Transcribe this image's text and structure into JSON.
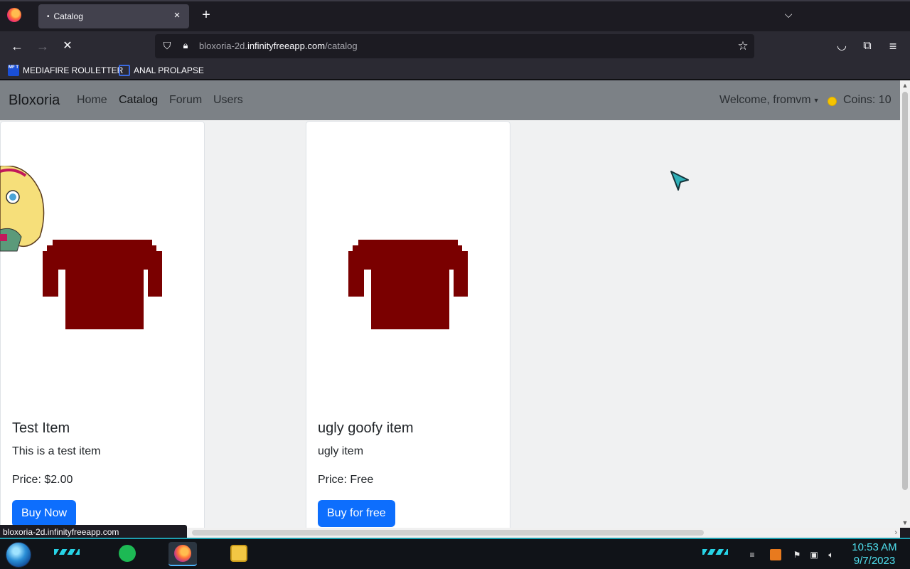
{
  "browser": {
    "tab_title": "Catalog",
    "tab_dot": "•",
    "close_glyph": "×",
    "new_tab_glyph": "+",
    "list_tabs_glyph": "⌵",
    "url_host_prefix": "bloxoria-2d.",
    "url_host_domain": "infinityfreeapp.com",
    "url_path": "/catalog",
    "status_text": "bloxoria-2d.infinityfreeapp.com",
    "bookmarks": [
      {
        "label": "MEDIAFIRE ROULETTER",
        "icon": "mediafire-icon",
        "icon_text": "MF T"
      },
      {
        "label": "ANAL PROLAPSE",
        "icon": "sigma-icon"
      }
    ],
    "icons": {
      "back": "←",
      "forward": "→",
      "stop": "✕",
      "shield": "⛉",
      "lock": "🔒︎",
      "star": "☆",
      "pocket": "◡",
      "extensions": "⧉",
      "menu": "≡"
    }
  },
  "site": {
    "brand": "Bloxoria",
    "nav": [
      "Home",
      "Catalog",
      "Forum",
      "Users"
    ],
    "active_nav": "Catalog",
    "welcome": "Welcome, fromvm",
    "caret": "▼",
    "coins": "Coins: 10",
    "coin_color": "#f5c400"
  },
  "catalog": {
    "items": [
      {
        "title": "Test Item",
        "description": "This is a test item",
        "price": "Price: $2.00",
        "button": "Buy Now",
        "shirt_color": "#7a0000"
      },
      {
        "title": "ugly goofy item",
        "description": "ugly item",
        "price": "Price: Free",
        "button": "Buy for free",
        "shirt_color": "#7a0000"
      }
    ]
  },
  "scroll": {
    "up": "▲",
    "down": "▼",
    "right": "›"
  },
  "taskbar": {
    "time": "10:53 AM",
    "date": "9/7/2023",
    "apps": [
      "notes-app-icon",
      "firefox-icon",
      "file-explorer-icon"
    ]
  },
  "colors": {
    "accent": "#0d6efd",
    "nav_bg": "#7c8186",
    "clock": "#4fe0ef"
  }
}
